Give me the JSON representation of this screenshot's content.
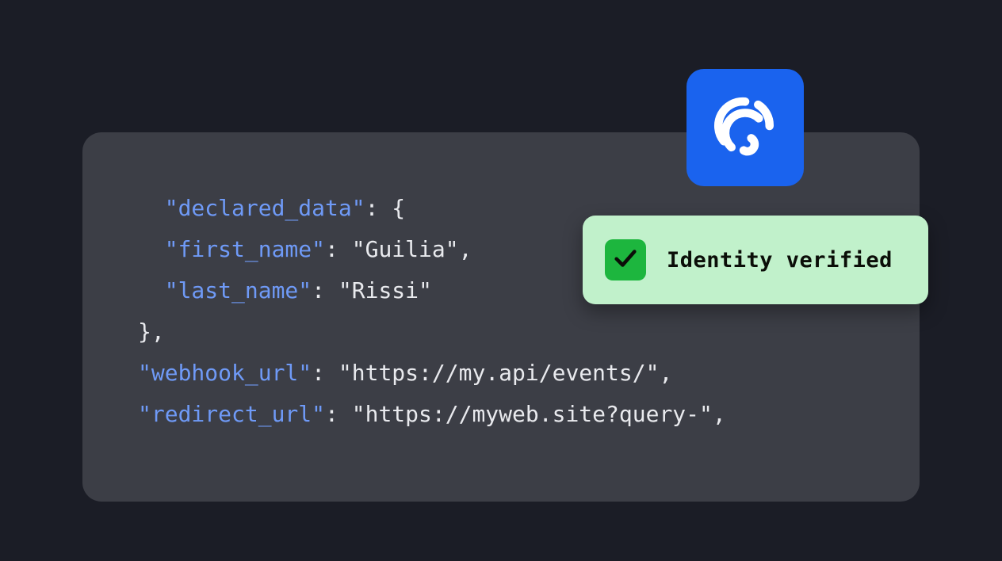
{
  "colors": {
    "page_bg": "#1b1d26",
    "panel_bg": "#3c3e46",
    "code_key": "#6f9af7",
    "code_text": "#e9eaee",
    "badge_bg": "#1a63ee",
    "verify_card_bg": "#c1f1cb",
    "verify_check_bg": "#1db63e",
    "verify_text": "#0b0e08"
  },
  "code": {
    "line1_key": "\"declared_data\"",
    "line1_rest": ": {",
    "line2_key": "\"first_name\"",
    "line2_rest": ": \"Guilia\",",
    "line3_key": "\"last_name\"",
    "line3_rest": ": \"Rissi\"",
    "line4": "},",
    "line5_key": "\"webhook_url\"",
    "line5_rest": ": \"https://my.api/events/\",",
    "line6_key": "\"redirect_url\"",
    "line6_rest": ": \"https://myweb.site?query-\","
  },
  "verify": {
    "label": "Identity verified"
  }
}
